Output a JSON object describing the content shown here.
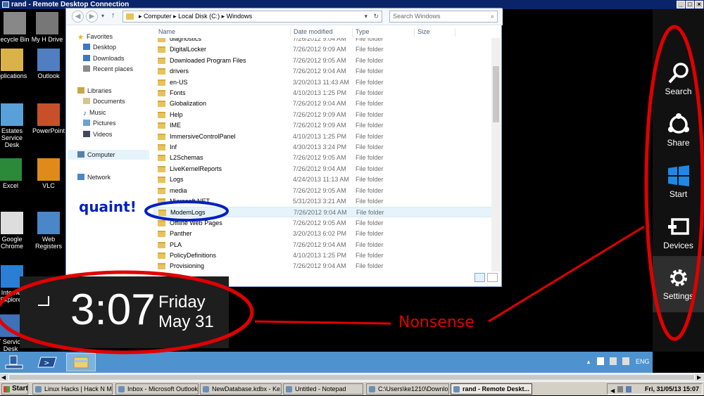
{
  "rdp": {
    "title": "rand - Remote Desktop Connection"
  },
  "desktop_icons": [
    {
      "label": "ecycle Bin"
    },
    {
      "label": "My H Drive"
    },
    {
      "label": "pplications"
    },
    {
      "label": "Outlook"
    },
    {
      "label": "Estates Service Desk"
    },
    {
      "label": "PowerPoint"
    },
    {
      "label": "Excel"
    },
    {
      "label": "VLC"
    },
    {
      "label": "Google Chrome"
    },
    {
      "label": "Web Registers"
    },
    {
      "label": "Internet Explorer"
    },
    {
      "label": "T Service Desk"
    }
  ],
  "explorer": {
    "breadcrumb": [
      "Computer",
      "Local Disk (C:)",
      "Windows"
    ],
    "search_placeholder": "Search Windows",
    "nav": {
      "favorites": "Favorites",
      "desktop": "Desktop",
      "downloads": "Downloads",
      "recent": "Recent places",
      "libraries": "Libraries",
      "documents": "Documents",
      "music": "Music",
      "pictures": "Pictures",
      "videos": "Videos",
      "computer": "Computer",
      "network": "Network"
    },
    "columns": {
      "name": "Name",
      "date": "Date modified",
      "type": "Type",
      "size": "Size"
    },
    "files": [
      {
        "name": "diagnostics",
        "date": "7/26/2012 9:04 AM",
        "type": "File folder"
      },
      {
        "name": "DigitalLocker",
        "date": "7/26/2012 9:09 AM",
        "type": "File folder"
      },
      {
        "name": "Downloaded Program Files",
        "date": "7/26/2012 9:05 AM",
        "type": "File folder"
      },
      {
        "name": "drivers",
        "date": "7/26/2012 9:04 AM",
        "type": "File folder"
      },
      {
        "name": "en-US",
        "date": "3/20/2013 11:43 AM",
        "type": "File folder"
      },
      {
        "name": "Fonts",
        "date": "4/10/2013 1:25 PM",
        "type": "File folder"
      },
      {
        "name": "Globalization",
        "date": "7/26/2012 9:04 AM",
        "type": "File folder"
      },
      {
        "name": "Help",
        "date": "7/26/2012 9:09 AM",
        "type": "File folder"
      },
      {
        "name": "IME",
        "date": "7/26/2012 9:09 AM",
        "type": "File folder"
      },
      {
        "name": "ImmersiveControlPanel",
        "date": "4/10/2013 1:25 PM",
        "type": "File folder"
      },
      {
        "name": "Inf",
        "date": "4/30/2013 3:24 PM",
        "type": "File folder"
      },
      {
        "name": "L2Schemas",
        "date": "7/26/2012 9:05 AM",
        "type": "File folder"
      },
      {
        "name": "LiveKernelReports",
        "date": "7/26/2012 9:04 AM",
        "type": "File folder"
      },
      {
        "name": "Logs",
        "date": "4/24/2013 11:13 AM",
        "type": "File folder"
      },
      {
        "name": "media",
        "date": "7/26/2012 9:05 AM",
        "type": "File folder"
      },
      {
        "name": "Microsoft.NET",
        "date": "5/31/2013 3:21 AM",
        "type": "File folder"
      },
      {
        "name": "ModemLogs",
        "date": "7/26/2012 9:04 AM",
        "type": "File folder"
      },
      {
        "name": "Offline Web Pages",
        "date": "7/26/2012 9:05 AM",
        "type": "File folder"
      },
      {
        "name": "Panther",
        "date": "3/20/2013 6:02 PM",
        "type": "File folder"
      },
      {
        "name": "PLA",
        "date": "7/26/2012 9:04 AM",
        "type": "File folder"
      },
      {
        "name": "PolicyDefinitions",
        "date": "4/10/2013 1:25 PM",
        "type": "File folder"
      },
      {
        "name": "Provisioning",
        "date": "7/26/2012 9:04 AM",
        "type": "File folder"
      }
    ]
  },
  "clock": {
    "time": "3:07",
    "day": "Friday",
    "date": "May 31"
  },
  "charms": [
    {
      "label": "Search",
      "icon": "search-icon"
    },
    {
      "label": "Share",
      "icon": "share-icon"
    },
    {
      "label": "Start",
      "icon": "windows-logo-icon"
    },
    {
      "label": "Devices",
      "icon": "devices-icon"
    },
    {
      "label": "Settings",
      "icon": "gear-icon"
    }
  ],
  "remote_taskbar": {
    "language": "ENG"
  },
  "xp_taskbar": {
    "start": "Start",
    "tasks": [
      {
        "label": "Linux Hacks | Hack N Mo..."
      },
      {
        "label": "Inbox - Microsoft Outlook"
      },
      {
        "label": "NewDatabase.kdbx - Ke..."
      },
      {
        "label": "Untitled - Notepad"
      },
      {
        "label": "C:\\Users\\ke1210\\Downlo..."
      },
      {
        "label": "rand - Remote Deskt..."
      }
    ],
    "clock": "Fri, 31/05/13 15:07"
  },
  "annotations": {
    "quaint": "quaint!",
    "nonsense": "Nonsense",
    "color_red": "#e00000",
    "color_blue": "#0020c0"
  }
}
